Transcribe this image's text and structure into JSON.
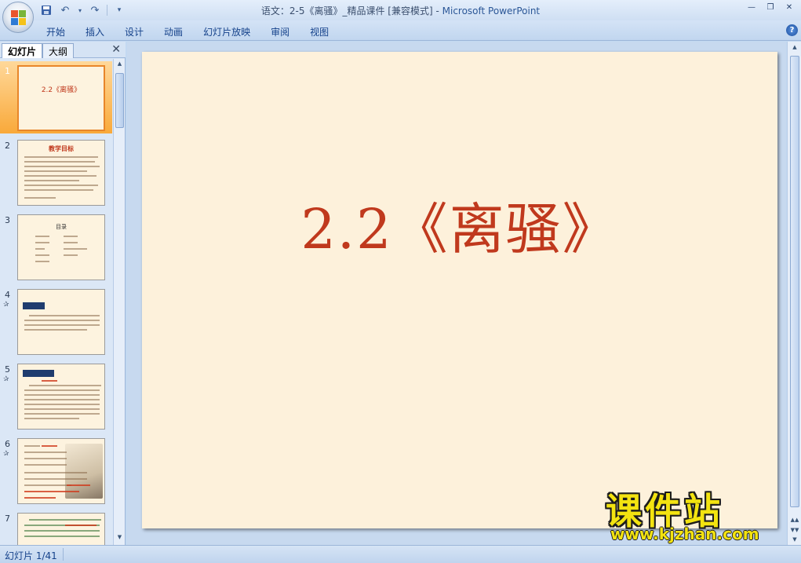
{
  "window": {
    "title_main": "语文：2-5《离骚》_精品课件 [兼容模式] - ",
    "title_brand": "Microsoft PowerPoint"
  },
  "quick_access": {
    "icons": [
      "save-icon",
      "undo-icon",
      "redo-icon",
      "customize-icon"
    ]
  },
  "ribbon": {
    "tabs": [
      "开始",
      "插入",
      "设计",
      "动画",
      "幻灯片放映",
      "审阅",
      "视图"
    ],
    "help_label": "?"
  },
  "panel": {
    "tab_slides": "幻灯片",
    "tab_outline": "大纲",
    "close_glyph": "✕"
  },
  "thumbnails": [
    {
      "num": "1",
      "title": "2.2《离骚》",
      "has_star": false,
      "selected": true
    },
    {
      "num": "2",
      "title": "教学目标",
      "has_star": false,
      "selected": false
    },
    {
      "num": "3",
      "title": "目录",
      "has_star": false,
      "selected": false
    },
    {
      "num": "4",
      "title": "",
      "has_star": true,
      "selected": false
    },
    {
      "num": "5",
      "title": "",
      "has_star": true,
      "selected": false
    },
    {
      "num": "6",
      "title": "",
      "has_star": true,
      "selected": false
    },
    {
      "num": "7",
      "title": "",
      "has_star": false,
      "selected": false
    }
  ],
  "slide": {
    "title": "2.2《离骚》"
  },
  "watermark": {
    "text": "课件站",
    "url": "www.kjzhan.com"
  },
  "status": {
    "slide_indicator": "幻灯片 1/41"
  },
  "colors": {
    "slide_bg": "#fdf1db",
    "title_red": "#c0391d",
    "selection_orange": "#f9a93a"
  }
}
